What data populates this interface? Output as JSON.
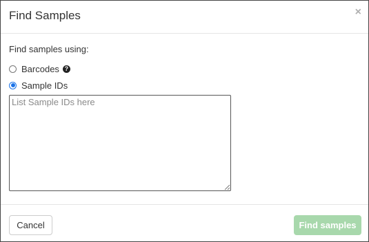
{
  "dialog": {
    "title": "Find Samples",
    "close_glyph": "×"
  },
  "form": {
    "intro_label": "Find samples using:",
    "options": [
      {
        "label": "Barcodes",
        "checked": false,
        "has_help_icon": true
      },
      {
        "label": "Sample IDs",
        "checked": true,
        "has_help_icon": false
      }
    ],
    "help_glyph": "?",
    "textarea": {
      "value": "",
      "placeholder": "List Sample IDs here"
    }
  },
  "footer": {
    "cancel_label": "Cancel",
    "find_label": "Find samples",
    "find_enabled": false
  },
  "colors": {
    "primary_disabled": "#a8d8ac",
    "radio_accent": "#1a73e8"
  },
  "icons": {
    "close": "close-icon",
    "help": "question-circle-icon",
    "resize": "resize-grip-icon"
  }
}
